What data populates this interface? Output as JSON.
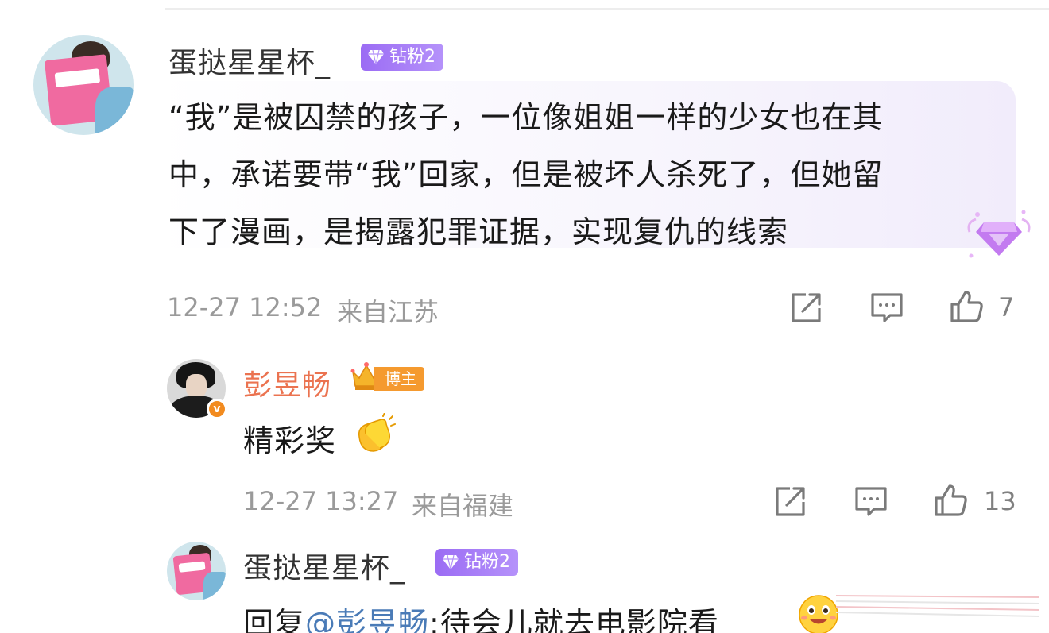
{
  "comment": {
    "username": "蛋挞星星杯_",
    "fan_badge": "钻粉2",
    "text_lines": [
      "“我”是被囚禁的孩子，一位像姐姐一样的少女也在其",
      "中，承诺要带“我”回家，但是被坏人杀死了，但她留",
      "下了漫画，是揭露犯罪证据，实现复仇的线索"
    ],
    "time": "12-27 12:52",
    "location": "来自江苏",
    "like_count": "7",
    "icons": [
      "share-icon",
      "comment-icon",
      "like-icon",
      "diamond-bubble-icon"
    ]
  },
  "reply1": {
    "username": "彭昱畅",
    "role_badge": "博主",
    "verify_mark": "v",
    "text": "精彩奖",
    "emoji": "clapping-hands-emoji",
    "time": "12-27 13:27",
    "location": "来自福建",
    "like_count": "13"
  },
  "reply2": {
    "username": "蛋挞星星杯_",
    "fan_badge": "钻粉2",
    "reply_prefix": "回复",
    "mention": "@彭昱畅",
    "text": ":待会儿就去电影院看",
    "emoji": "grinning-face-emoji"
  },
  "colors": {
    "username": "#333333",
    "blogger_name": "#eb7350",
    "mention": "#4a7bb7",
    "meta": "#9a9a9a",
    "fan_badge": "#9b6cf4",
    "blogger_badge": "#f59a2f"
  }
}
